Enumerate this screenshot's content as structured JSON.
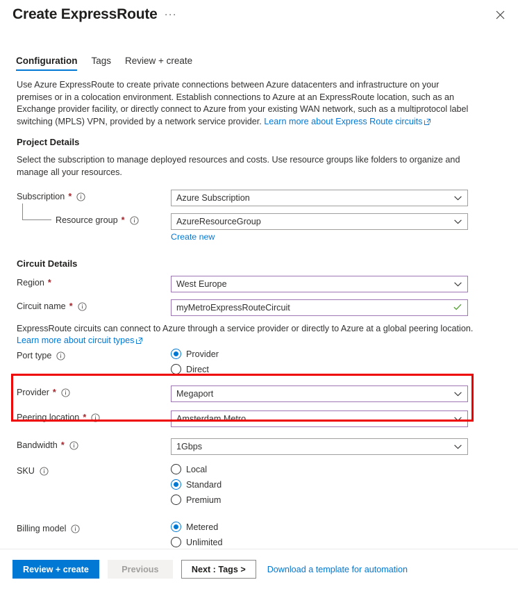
{
  "header": {
    "title": "Create ExpressRoute",
    "ellipsis": "···",
    "close_label": "close-icon"
  },
  "tabs": [
    {
      "label": "Configuration",
      "active": true
    },
    {
      "label": "Tags",
      "active": false
    },
    {
      "label": "Review + create",
      "active": false
    }
  ],
  "intro": {
    "text": "Use Azure ExpressRoute to create private connections between Azure datacenters and infrastructure on your premises or in a colocation environment. Establish connections to Azure at an ExpressRoute location, such as an Exchange provider facility, or directly connect to Azure from your existing WAN network, such as a multiprotocol label switching (MPLS) VPN, provided by a network service provider.",
    "link_label": "Learn more about Express Route circuits"
  },
  "project_details": {
    "heading": "Project Details",
    "description": "Select the subscription to manage deployed resources and costs. Use resource groups like folders to organize and manage all your resources.",
    "subscription": {
      "label": "Subscription",
      "required": "*",
      "value": "Azure Subscription"
    },
    "resource_group": {
      "label": "Resource group",
      "required": "*",
      "value": "AzureResourceGroup",
      "create_new_label": "Create new"
    }
  },
  "circuit_details": {
    "heading": "Circuit Details",
    "region": {
      "label": "Region",
      "required": "*",
      "value": "West Europe"
    },
    "circuit_name": {
      "label": "Circuit name",
      "required": "*",
      "value": "myMetroExpressRouteCircuit"
    },
    "note": "ExpressRoute circuits can connect to Azure through a service provider or directly to Azure at a global peering location.",
    "note_link": "Learn more about circuit types",
    "port_type": {
      "label": "Port type",
      "options": [
        {
          "label": "Provider",
          "selected": true
        },
        {
          "label": "Direct",
          "selected": false
        }
      ]
    },
    "provider": {
      "label": "Provider",
      "required": "*",
      "value": "Megaport"
    },
    "peering_location": {
      "label": "Peering location",
      "required": "*",
      "value": "Amsterdam Metro"
    },
    "bandwidth": {
      "label": "Bandwidth",
      "required": "*",
      "value": "1Gbps"
    },
    "sku": {
      "label": "SKU",
      "options": [
        {
          "label": "Local",
          "selected": false
        },
        {
          "label": "Standard",
          "selected": true
        },
        {
          "label": "Premium",
          "selected": false
        }
      ]
    },
    "billing_model": {
      "label": "Billing model",
      "options": [
        {
          "label": "Metered",
          "selected": true
        },
        {
          "label": "Unlimited",
          "selected": false
        }
      ]
    }
  },
  "footer": {
    "review_create": "Review + create",
    "previous": "Previous",
    "next": "Next : Tags >",
    "download_template": "Download a template for automation"
  },
  "colors": {
    "accent": "#0078d4",
    "required_red": "#a4262c",
    "annotation_red": "#ef0000",
    "validated_border": "#9f76b4",
    "valid_check": "#5ba53c"
  }
}
